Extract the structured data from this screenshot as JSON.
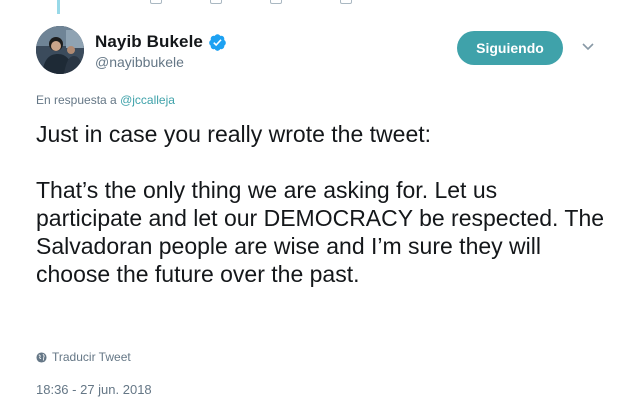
{
  "author": {
    "display_name": "Nayib Bukele",
    "handle": "@nayibbukele",
    "verified": true,
    "verified_icon": "verified-badge-icon",
    "avatar": "avatar-photo"
  },
  "follow_button": {
    "label": "Siguiendo",
    "color": "#3fa2aa"
  },
  "reply": {
    "prefix": "En respuesta a",
    "mention": "@jccalleja"
  },
  "tweet": {
    "text": "Just in case you really wrote the tweet:\n\nThat’s the only thing we are asking for. Let us participate and let our DEMOCRACY be respected. The Salvadoran people are wise and I’m sure they will choose the future over the past."
  },
  "translate": {
    "label": "Traducir Tweet",
    "icon": "globe-icon"
  },
  "timestamp": "18:36 - 27 jun. 2018",
  "colors": {
    "accent": "#3fa2aa",
    "verified": "#1da1f2",
    "muted": "#657786",
    "text": "#14171a"
  }
}
